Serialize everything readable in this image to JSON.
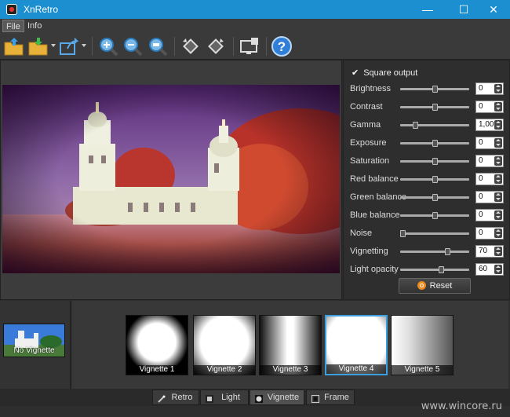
{
  "window": {
    "title": "XnRetro",
    "minimize_glyph": "—",
    "maximize_glyph": "☐",
    "close_glyph": "✕"
  },
  "menu": {
    "items": [
      {
        "label": "File"
      },
      {
        "label": "Info"
      }
    ]
  },
  "toolbar": {
    "icons": [
      "open-folder-icon",
      "save-folder-icon",
      "share-icon",
      "zoom-in-icon",
      "zoom-out-icon",
      "zoom-fit-icon",
      "rotate-left-icon",
      "rotate-right-icon",
      "wallpaper-icon",
      "help-icon"
    ]
  },
  "panel": {
    "square_output": {
      "label": "Square output",
      "checked": true
    },
    "params": [
      {
        "label": "Brightness",
        "value": "0",
        "level": 0.5
      },
      {
        "label": "Contrast",
        "value": "0",
        "level": 0.5
      },
      {
        "label": "Gamma",
        "value": "1,00",
        "level": 0.2
      },
      {
        "label": "Exposure",
        "value": "0",
        "level": 0.5
      },
      {
        "label": "Saturation",
        "value": "0",
        "level": 0.5
      },
      {
        "label": "Red balance",
        "value": "0",
        "level": 0.5
      },
      {
        "label": "Green balance",
        "value": "0",
        "level": 0.5
      },
      {
        "label": "Blue balance",
        "value": "0",
        "level": 0.5
      },
      {
        "label": "Noise",
        "value": "0",
        "level": 0.0
      },
      {
        "label": "Vignetting",
        "value": "70",
        "level": 0.7
      },
      {
        "label": "Light opacity",
        "value": "60",
        "level": 0.6
      }
    ],
    "reset_label": "Reset"
  },
  "presets": {
    "no_vignette": {
      "label": "No Vignette"
    },
    "vignettes": [
      {
        "label": "Vignette 1",
        "selected": false
      },
      {
        "label": "Vignette 2",
        "selected": false
      },
      {
        "label": "Vignette 3",
        "selected": false
      },
      {
        "label": "Vignette 4",
        "selected": true
      },
      {
        "label": "Vignette 5",
        "selected": false
      }
    ]
  },
  "tabs": [
    {
      "label": "Retro",
      "icon": "wand-icon",
      "active": false
    },
    {
      "label": "Light",
      "icon": "film-icon",
      "active": false
    },
    {
      "label": "Vignette",
      "icon": "vignette-icon",
      "active": true
    },
    {
      "label": "Frame",
      "icon": "frame-icon",
      "active": false
    }
  ],
  "watermark": "www.wincore.ru",
  "colors": {
    "accent": "#1c8fd0",
    "selection": "#3a9ee0",
    "reset_icon": "#f08a1c"
  }
}
